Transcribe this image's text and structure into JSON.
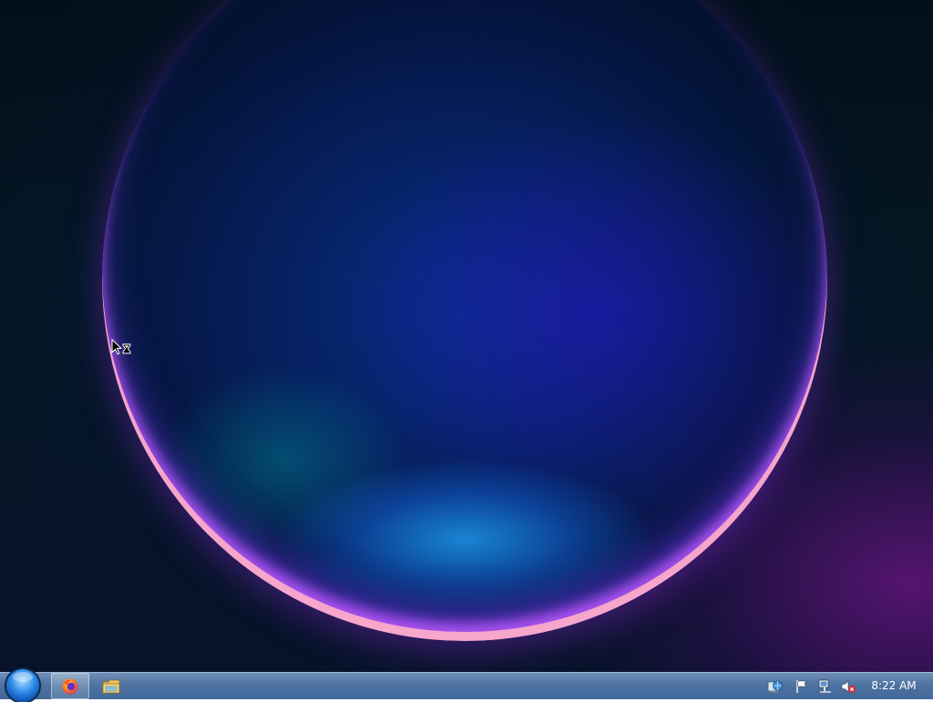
{
  "taskbar": {
    "clock_time": "8:22 AM",
    "pinned_apps": [
      "firefox-icon",
      "file-explorer-icon"
    ],
    "tray_icons": [
      "network-globe-icon",
      "action-center-flag-icon",
      "network-icon",
      "volume-muted-icon"
    ]
  },
  "desktop": {
    "cursor_state": "busy-hourglass"
  },
  "colors": {
    "taskbar": "#4e73a1",
    "start_orb": "#2d8ae8",
    "accent_purple": "#b04cff"
  }
}
